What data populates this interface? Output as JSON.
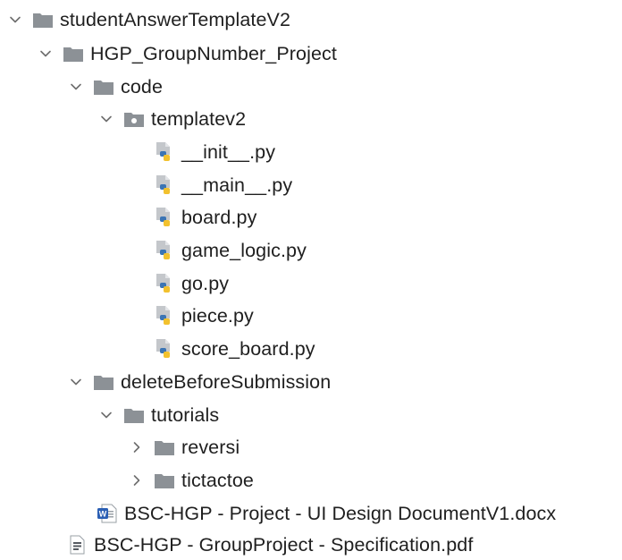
{
  "tree": {
    "items": [
      {
        "label": "studentAnswerTemplateV2",
        "icon": "folder-icon",
        "state": "expanded"
      },
      {
        "label": "HGP_GroupNumber_Project",
        "icon": "folder-icon",
        "state": "expanded"
      },
      {
        "label": "code",
        "icon": "folder-icon",
        "state": "expanded"
      },
      {
        "label": "templatev2",
        "icon": "package-folder-icon",
        "state": "expanded"
      },
      {
        "label": "__init__.py",
        "icon": "python-file-icon"
      },
      {
        "label": "__main__.py",
        "icon": "python-file-icon"
      },
      {
        "label": "board.py",
        "icon": "python-file-icon"
      },
      {
        "label": "game_logic.py",
        "icon": "python-file-icon"
      },
      {
        "label": "go.py",
        "icon": "python-file-icon"
      },
      {
        "label": "piece.py",
        "icon": "python-file-icon"
      },
      {
        "label": "score_board.py",
        "icon": "python-file-icon"
      },
      {
        "label": "deleteBeforeSubmission",
        "icon": "folder-icon",
        "state": "expanded"
      },
      {
        "label": "tutorials",
        "icon": "folder-icon",
        "state": "expanded"
      },
      {
        "label": "reversi",
        "icon": "folder-icon",
        "state": "collapsed"
      },
      {
        "label": "tictactoe",
        "icon": "folder-icon",
        "state": "collapsed"
      },
      {
        "label": "BSC-HGP - Project - UI Design DocumentV1.docx",
        "icon": "word-document-icon"
      },
      {
        "label": "BSC-HGP - GroupProject - Specification.pdf",
        "icon": "pdf-file-icon"
      }
    ]
  },
  "colors": {
    "text": "#1f1f1f",
    "folder": "#8c9196",
    "chevron": "#6e6e6e",
    "python_blue": "#3b74b4",
    "python_yellow": "#f2c12e",
    "word_blue": "#2b5fb4"
  }
}
